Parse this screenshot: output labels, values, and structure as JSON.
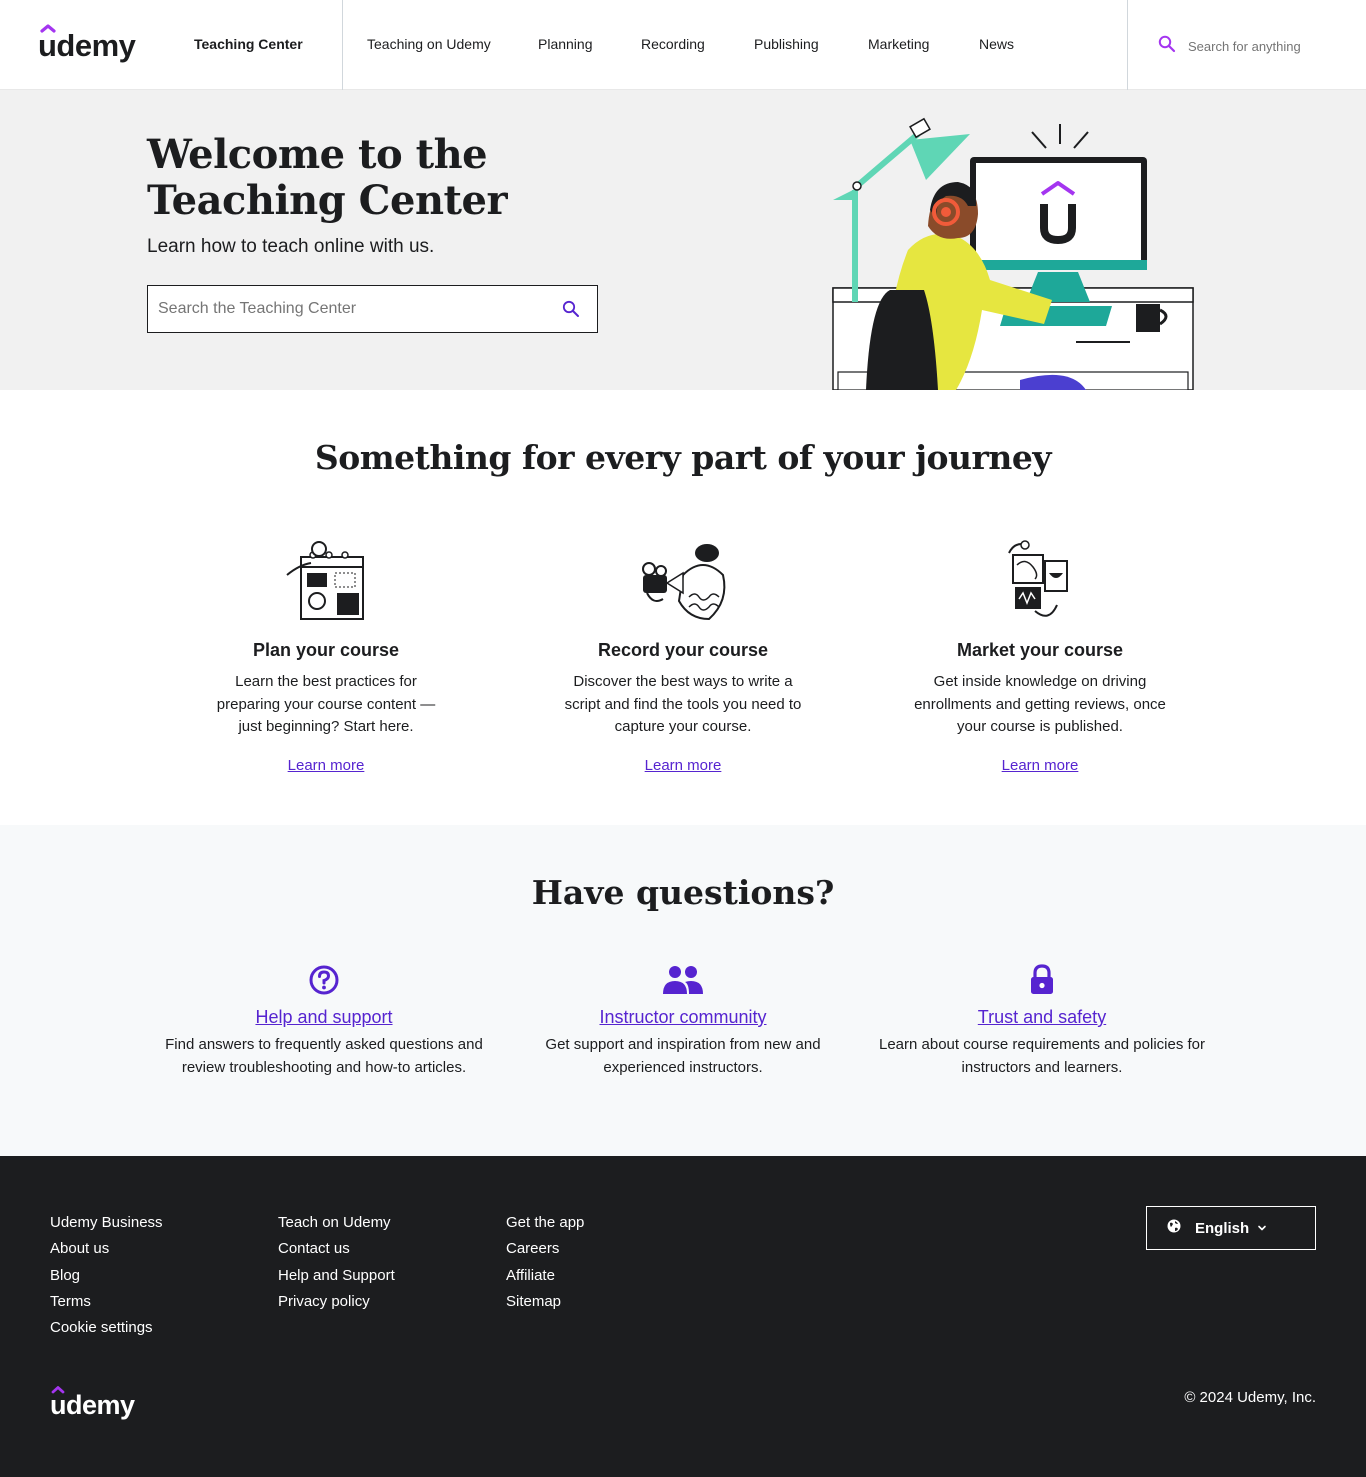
{
  "header": {
    "logo_text": "udemy",
    "teaching_center": "Teaching Center",
    "nav": [
      "Teaching on Udemy",
      "Planning",
      "Recording",
      "Publishing",
      "Marketing",
      "News"
    ],
    "search_placeholder": "Search for anything"
  },
  "hero": {
    "title_line1": "Welcome to the",
    "title_line2": "Teaching Center",
    "subtitle": "Learn how to teach online with us.",
    "search_placeholder": "Search the Teaching Center"
  },
  "journey": {
    "title": "Something for every part of your journey",
    "cards": [
      {
        "title": "Plan your course",
        "text": "Learn the best practices for preparing your course content — just beginning? Start here.",
        "link": "Learn more"
      },
      {
        "title": "Record your course",
        "text": "Discover the best ways to write a script and find the tools you need to capture your course.",
        "link": "Learn more"
      },
      {
        "title": "Market your course",
        "text": "Get inside knowledge on driving enrollments and getting reviews, once your course is published.",
        "link": "Learn more"
      }
    ]
  },
  "questions": {
    "title": "Have questions?",
    "items": [
      {
        "title": "Help and support",
        "text": "Find answers to frequently asked questions and review troubleshooting and how-to articles."
      },
      {
        "title": "Instructor community",
        "text": "Get support and inspiration from new and experienced instructors."
      },
      {
        "title": "Trust and safety",
        "text": "Learn about course requirements and policies for instructors and learners."
      }
    ]
  },
  "footer": {
    "col1": [
      "Udemy Business",
      "About us",
      "Blog",
      "Terms",
      "Cookie settings"
    ],
    "col2": [
      "Teach on Udemy",
      "Contact us",
      "Help and Support",
      "Privacy policy"
    ],
    "col3": [
      "Get the app",
      "Careers",
      "Affiliate",
      "Sitemap"
    ],
    "language": "English",
    "logo_text": "udemy",
    "copyright": "© 2024 Udemy, Inc."
  },
  "colors": {
    "brand_purple": "#a435f0",
    "link_purple": "#5624d0",
    "dark": "#1c1d1f"
  }
}
